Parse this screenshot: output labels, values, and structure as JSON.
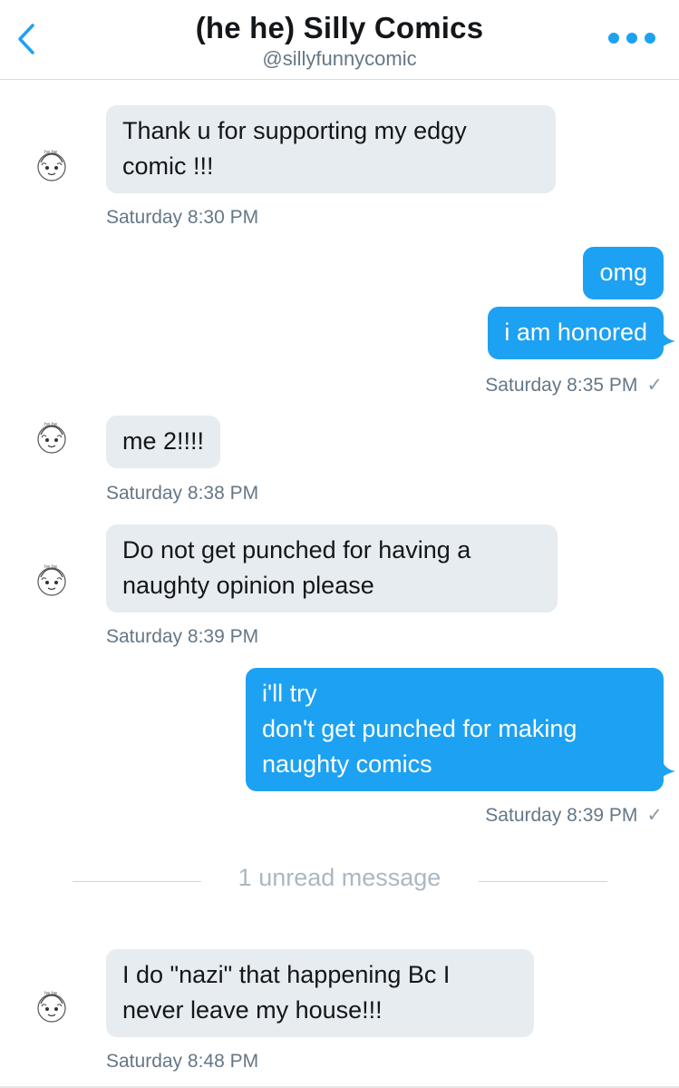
{
  "header": {
    "title": "(he he) Silly Comics",
    "handle": "@sillyfunnycomic",
    "back_icon": "chevron-left-icon",
    "more_icon": "more-horizontal-icon"
  },
  "colors": {
    "accent": "#1da1f2",
    "incoming_bubble": "#e6ecf0",
    "timestamp": "#657786"
  },
  "messages": [
    {
      "direction": "incoming",
      "text": "Thank u for supporting my edgy\ncomic !!!",
      "time": "Saturday 8:30 PM"
    },
    {
      "direction": "outgoing",
      "text": "omg"
    },
    {
      "direction": "outgoing",
      "text": "i am honored",
      "time": "Saturday 8:35 PM",
      "read_check": "✓"
    },
    {
      "direction": "incoming",
      "text": "me 2!!!!",
      "time": "Saturday 8:38 PM"
    },
    {
      "direction": "incoming",
      "text": "Do not get punched for having a\nnaughty opinion please",
      "time": "Saturday 8:39 PM"
    },
    {
      "direction": "outgoing",
      "text": "i'll try\ndon't get punched for making\nnaughty comics",
      "time": "Saturday 8:39 PM",
      "read_check": "✓"
    },
    {
      "direction": "incoming",
      "text": "I do \"nazi\" that happening Bc I\nnever leave my house!!!",
      "time": "Saturday 8:48 PM"
    }
  ],
  "unread_divider": "1 unread message"
}
